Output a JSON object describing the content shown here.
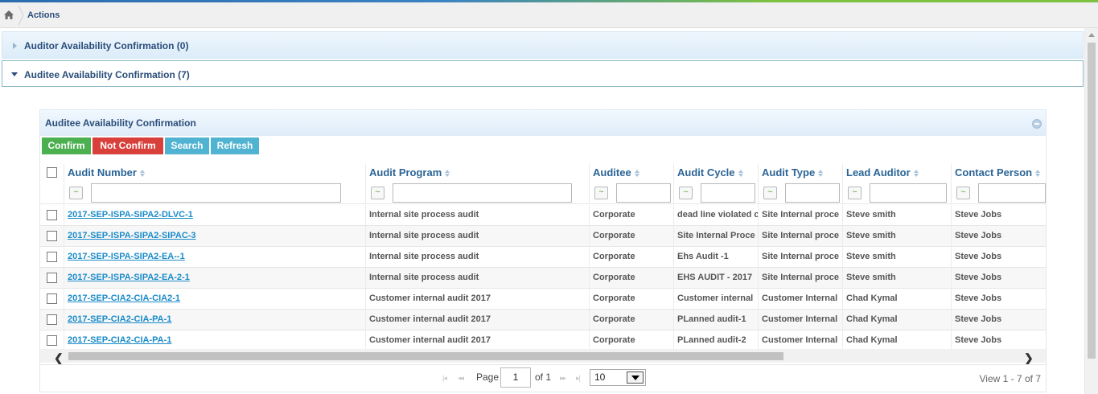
{
  "breadcrumb": {
    "items": [
      "Actions"
    ]
  },
  "accordion": [
    {
      "label": "Auditor Availability Confirmation (0)",
      "expanded": false
    },
    {
      "label": "Auditee Availability Confirmation (7)",
      "expanded": true
    }
  ],
  "grid": {
    "caption": "Auditee Availability Confirmation",
    "toolbar": {
      "confirm": "Confirm",
      "not_confirm": "Not Confirm",
      "search": "Search",
      "refresh": "Refresh"
    },
    "columns": [
      "Audit Number",
      "Audit Program",
      "Auditee",
      "Audit Cycle",
      "Audit Type",
      "Lead Auditor",
      "Contact Person"
    ],
    "filter_operator": "~",
    "rows": [
      [
        "2017-SEP-ISPA-SIPA2-DLVC-1",
        "Internal site process audit",
        "Corporate",
        "dead line violated c",
        "Site Internal proce",
        "Steve smith",
        "Steve Jobs"
      ],
      [
        "2017-SEP-ISPA-SIPA2-SIPAC-3",
        "Internal site process audit",
        "Corporate",
        "Site Internal Proce",
        "Site Internal proce",
        "Steve smith",
        "Steve Jobs"
      ],
      [
        "2017-SEP-ISPA-SIPA2-EA--1",
        "Internal site process audit",
        "Corporate",
        "Ehs Audit -1",
        "Site Internal proce",
        "Steve smith",
        "Steve Jobs"
      ],
      [
        "2017-SEP-ISPA-SIPA2-EA-2-1",
        "Internal site process audit",
        "Corporate",
        "EHS AUDIT - 2017",
        "Site Internal proce",
        "Steve smith",
        "Steve Jobs"
      ],
      [
        "2017-SEP-CIA2-CIA-CIA2-1",
        "Customer internal audit 2017",
        "Corporate",
        "Customer internal",
        "Customer Internal",
        "Chad Kymal",
        "Steve Jobs"
      ],
      [
        "2017-SEP-CIA2-CIA-PA-1",
        "Customer internal audit 2017",
        "Corporate",
        "PLanned audit-1",
        "Customer Internal",
        "Chad Kymal",
        "Steve Jobs"
      ],
      [
        "2017-SEP-CIA2-CIA-PA-1",
        "Customer internal audit 2017",
        "Corporate",
        "PLanned audit-2",
        "Customer Internal",
        "Chad Kymal",
        "Steve Jobs"
      ]
    ],
    "pager": {
      "page_label": "Page",
      "page_value": "1",
      "of_label": "of 1",
      "page_size": "10",
      "view_text": "View 1 - 7 of 7"
    }
  },
  "colors": {
    "confirm": "#4caf50",
    "not_confirm": "#d9403b",
    "action": "#51b3d2",
    "link": "#1a8bc9",
    "header_text": "#2a4d7a"
  }
}
